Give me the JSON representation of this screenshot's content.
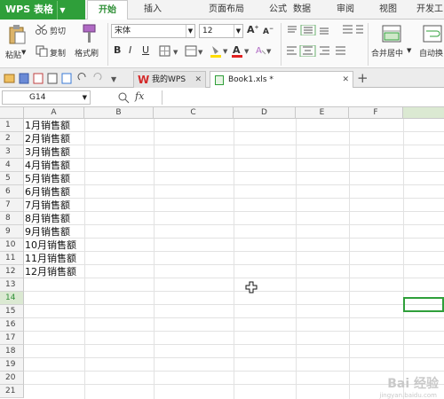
{
  "app": {
    "title": "WPS 表格"
  },
  "menu_tabs": [
    "开始",
    "插入",
    "页面布局",
    "公式",
    "数据",
    "审阅",
    "视图",
    "开发工"
  ],
  "ribbon": {
    "paste": "粘贴",
    "cut": "剪切",
    "copy": "复制",
    "format_painter": "格式刷",
    "font_name": "宋体",
    "font_size": "12",
    "merge_center": "合并居中",
    "auto_wrap": "自动换"
  },
  "doc_tabs": [
    {
      "label": "我的WPS",
      "active": false
    },
    {
      "label": "Book1.xls *",
      "active": true
    }
  ],
  "formula_bar": {
    "name_box": "G14",
    "fx": "fx",
    "formula": ""
  },
  "grid": {
    "columns": [
      "A",
      "B",
      "C",
      "D",
      "E",
      "F"
    ],
    "rows": [
      "1",
      "2",
      "3",
      "4",
      "5",
      "6",
      "7",
      "8",
      "9",
      "10",
      "11",
      "12",
      "13",
      "14",
      "15",
      "16",
      "17",
      "18",
      "19",
      "20",
      "21"
    ],
    "selected_row": "14",
    "cells_A": [
      "1月销售额",
      "2月销售额",
      "3月销售额",
      "4月销售额",
      "5月销售额",
      "6月销售额",
      "7月销售额",
      "8月销售额",
      "9月销售额",
      "10月销售额",
      "11月销售额",
      "12月销售额"
    ]
  },
  "watermark": {
    "text": "Bai 经验",
    "sub": "jingyan.baidu.com"
  },
  "colors": {
    "accent": "#2f9f3a"
  }
}
